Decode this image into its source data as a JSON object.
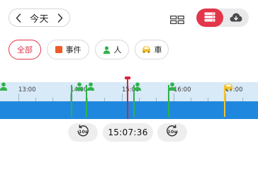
{
  "header": {
    "date_label": "今天",
    "prev_icon": "chevron-left-icon",
    "next_icon": "chevron-right-icon",
    "view_toggle_icon": "grid-icon",
    "storage_toggle": {
      "local_icon": "server-icon",
      "cloud_icon": "cloud-icon",
      "selected": "local"
    }
  },
  "filters": {
    "all_label": "全部",
    "event_label": "事件",
    "person_label": "人",
    "car_label": "車",
    "active": "all"
  },
  "timeline": {
    "tick_labels": [
      "13:00",
      "14:00",
      "15:00",
      "16:00",
      "17:00"
    ],
    "current_time": "15:07:36",
    "events": [
      {
        "type": "person",
        "color": "#2fb24a"
      },
      {
        "type": "person",
        "color": "#2fb24a"
      },
      {
        "type": "person",
        "color": "#2fb24a"
      },
      {
        "type": "person",
        "color": "#2fb24a"
      },
      {
        "type": "person",
        "color": "#2fb24a"
      },
      {
        "type": "car",
        "color": "#f2c12e"
      }
    ]
  },
  "controls": {
    "back_label": "10s",
    "forward_label": "10s",
    "back_icon": "rewind-10s-icon",
    "forward_icon": "forward-10s-icon"
  },
  "colors": {
    "accent": "#e2364a",
    "timeline_bar": "#1f88de",
    "timeline_ruler": "#d8e9f7",
    "person": "#2fb24a",
    "car": "#f2c12e",
    "event": "#f05a28"
  }
}
